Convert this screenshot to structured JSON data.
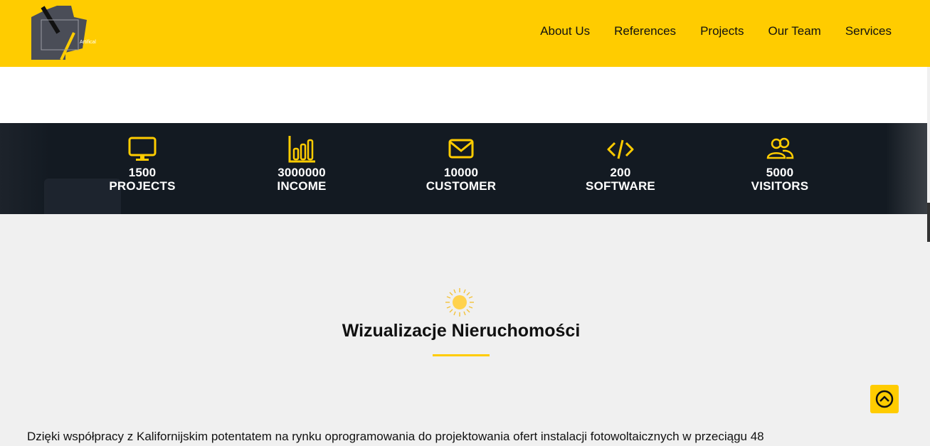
{
  "header": {
    "logo_text": "Artifical",
    "nav": [
      "About Us",
      "References",
      "Projects",
      "Our Team",
      "Services"
    ]
  },
  "stats": [
    {
      "icon": "monitor-icon",
      "value": "1500",
      "label": "PROJECTS"
    },
    {
      "icon": "bar-chart-icon",
      "value": "3000000",
      "label": "INCOME"
    },
    {
      "icon": "envelope-icon",
      "value": "10000",
      "label": "CUSTOMER"
    },
    {
      "icon": "code-icon",
      "value": "200",
      "label": "SOFTWARE"
    },
    {
      "icon": "users-icon",
      "value": "5000",
      "label": "VISITORS"
    }
  ],
  "section": {
    "icon": "sun-icon",
    "title": "Wizualizacje Nieruchomości"
  },
  "body": {
    "text": "Dzięki współpracy z Kalifornijskim potentatem na rynku oprogramowania do projektowania ofert instalacji fotowoltaicznych w przeciągu 48"
  },
  "scroll_top": {
    "icon": "arrow-up-circle-icon"
  },
  "colors": {
    "accent": "#ffcc00",
    "dark_band": "#131a22",
    "text": "#111111"
  }
}
